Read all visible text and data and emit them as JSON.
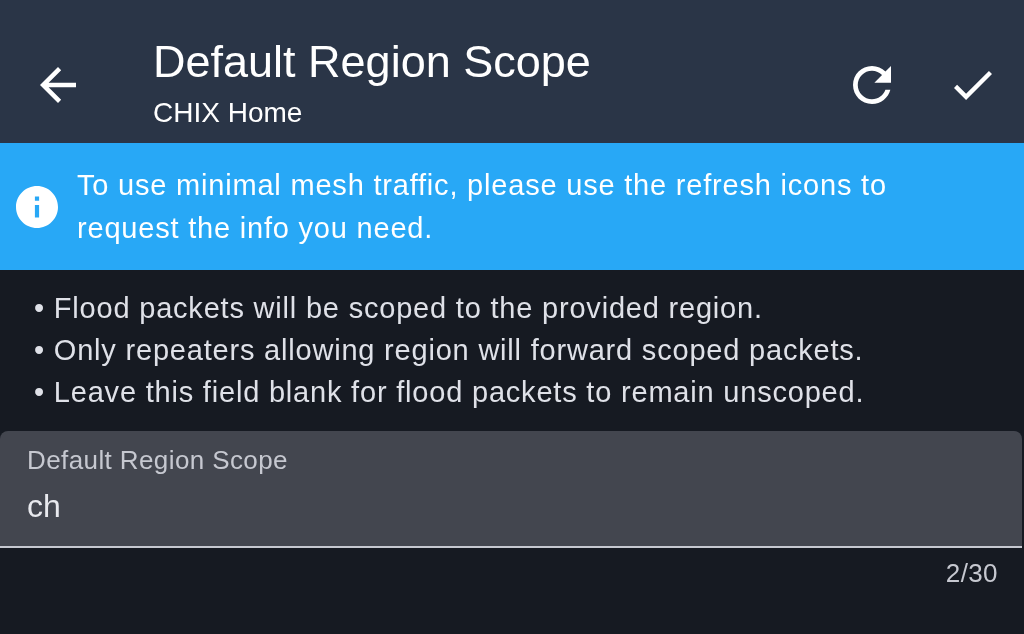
{
  "app_bar": {
    "title": "Default Region Scope",
    "subtitle": "CHIX Home"
  },
  "info_banner": {
    "message": "To use minimal mesh traffic, please use the refresh icons to request the info you need."
  },
  "notes": [
    "• Flood packets will be scoped to the provided region.",
    "• Only repeaters allowing region will forward scoped packets.",
    "• Leave this field blank for flood packets to remain unscoped."
  ],
  "region_field": {
    "label": "Default Region Scope",
    "value": "ch",
    "counter": "2/30"
  }
}
